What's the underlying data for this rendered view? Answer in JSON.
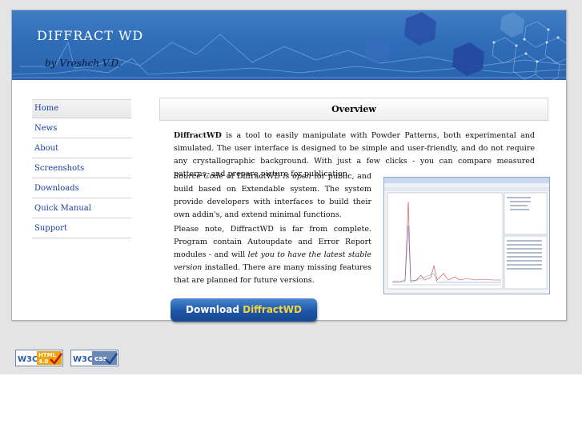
{
  "header": {
    "title": "DIFFRACT WD",
    "author": "by Vreshch V.D."
  },
  "nav": {
    "items": [
      {
        "label": "Home"
      },
      {
        "label": "News"
      },
      {
        "label": "About"
      },
      {
        "label": "Screenshots"
      },
      {
        "label": "Downloads"
      },
      {
        "label": "Quick Manual"
      },
      {
        "label": "Support"
      }
    ],
    "active_index": 0
  },
  "content": {
    "section_title": "Overview",
    "intro_bold": "DiffractWD",
    "intro_rest": " is a tool to easily manipulate with Powder Patterns, both experimental and simulated. The user interface is designed to be simple and user-friendly, and do not require any crystallographic background. With just a few clicks - you can compare measured patterns, and prepare picture for publication.",
    "p2_italic1": "Source Code",
    "p2_of": " of DiffractWD ",
    "p2_italic2": "is open",
    "p2_rest": " for public, and build based on Extendable system. The system provide developers with interfaces to build their own addin's, and extend minimal functions.",
    "p3_start": "Please note, DiffractWD is far from complete. Program contain Autoupdate and Error Report modules - and will ",
    "p3_italic": "let you to have the latest stable version",
    "p3_rest": " installed. There are many missing features that are planned for future versions.",
    "download_word": "Download",
    "download_product": "DiffractWD"
  },
  "badges": {
    "html_w3c": "W3C",
    "html_label": "HTML",
    "html_version": "4.0",
    "css_w3c": "W3C",
    "css_label": "css"
  },
  "colors": {
    "header_blue": "#2f6db8",
    "nav_link": "#1a3ea0",
    "download_accent": "#f2d53c"
  }
}
